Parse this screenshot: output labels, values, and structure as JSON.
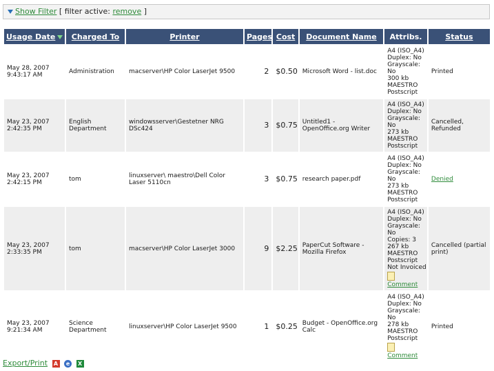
{
  "filter": {
    "toggle_label": "Show Filter",
    "active_prefix": "[ filter active: ",
    "remove_label": "remove",
    "active_suffix": " ]"
  },
  "table": {
    "columns": {
      "usage_date": "Usage Date",
      "charged_to": "Charged To",
      "printer": "Printer",
      "pages": "Pages",
      "cost": "Cost",
      "document_name": "Document Name",
      "attribs": "Attribs.",
      "status": "Status"
    },
    "sort_indicator": "sort-descending",
    "rows": [
      {
        "date": "May 28, 2007",
        "time": "9:43:17 AM",
        "charged_to": "Administration",
        "printer": "macserver\\HP Color LaserJet 9500",
        "pages": "2",
        "cost": "$0.50",
        "document": "Microsoft Word - list.doc",
        "attribs": [
          "A4 (ISO_A4)",
          "Duplex: No",
          "Grayscale:",
          "No",
          "300 kb",
          "MAESTRO",
          "Postscript"
        ],
        "comment": "",
        "status": "Printed"
      },
      {
        "date": "May 23, 2007",
        "time": "2:42:35 PM",
        "charged_to": "English Department",
        "printer": "windowsserver\\Gestetner NRG DSc424",
        "pages": "3",
        "cost": "$0.75",
        "document": "Untitled1 - OpenOffice.org Writer",
        "attribs": [
          "A4 (ISO_A4)",
          "Duplex: No",
          "Grayscale:",
          "No",
          "273 kb",
          "MAESTRO",
          "Postscript"
        ],
        "comment": "",
        "status": "Cancelled, Refunded"
      },
      {
        "date": "May 23, 2007",
        "time": "2:42:15 PM",
        "charged_to": "tom",
        "printer": "linuxserver\\ maestro\\Dell Color Laser 5110cn",
        "pages": "3",
        "cost": "$0.75",
        "document": "research paper.pdf",
        "attribs": [
          "A4 (ISO_A4)",
          "Duplex: No",
          "Grayscale:",
          "No",
          "273 kb",
          "MAESTRO",
          "Postscript"
        ],
        "comment": "",
        "status": "Denied"
      },
      {
        "date": "May 23, 2007",
        "time": "2:33:35 PM",
        "charged_to": "tom",
        "printer": "macserver\\HP Color LaserJet 3000",
        "pages": "9",
        "cost": "$2.25",
        "document": "PaperCut Software - Mozilla Firefox",
        "attribs": [
          "A4 (ISO_A4)",
          "Duplex: No",
          "Grayscale:",
          "No",
          "Copies: 3",
          "267 kb",
          "MAESTRO",
          "Postscript",
          "Not Invoiced"
        ],
        "comment": "Comment",
        "status": "Cancelled (partial print)"
      },
      {
        "date": "May 23, 2007",
        "time": "9:21:34 AM",
        "charged_to": "Science Department",
        "printer": "linuxserver\\HP Color LaserJet 9500",
        "pages": "1",
        "cost": "$0.25",
        "document": "Budget - OpenOffice.org Calc",
        "attribs": [
          "A4 (ISO_A4)",
          "Duplex: No",
          "Grayscale:",
          "No",
          "278 kb",
          "MAESTRO",
          "Postscript"
        ],
        "comment": "Comment",
        "status": "Printed"
      }
    ]
  },
  "footer": {
    "export_label": "Export/Print",
    "icons": [
      "pdf-icon",
      "html-icon",
      "excel-icon"
    ]
  },
  "colors": {
    "header_bg": "#3a5177",
    "link": "#2e8b3a",
    "row_alt": "#eeeeee"
  }
}
